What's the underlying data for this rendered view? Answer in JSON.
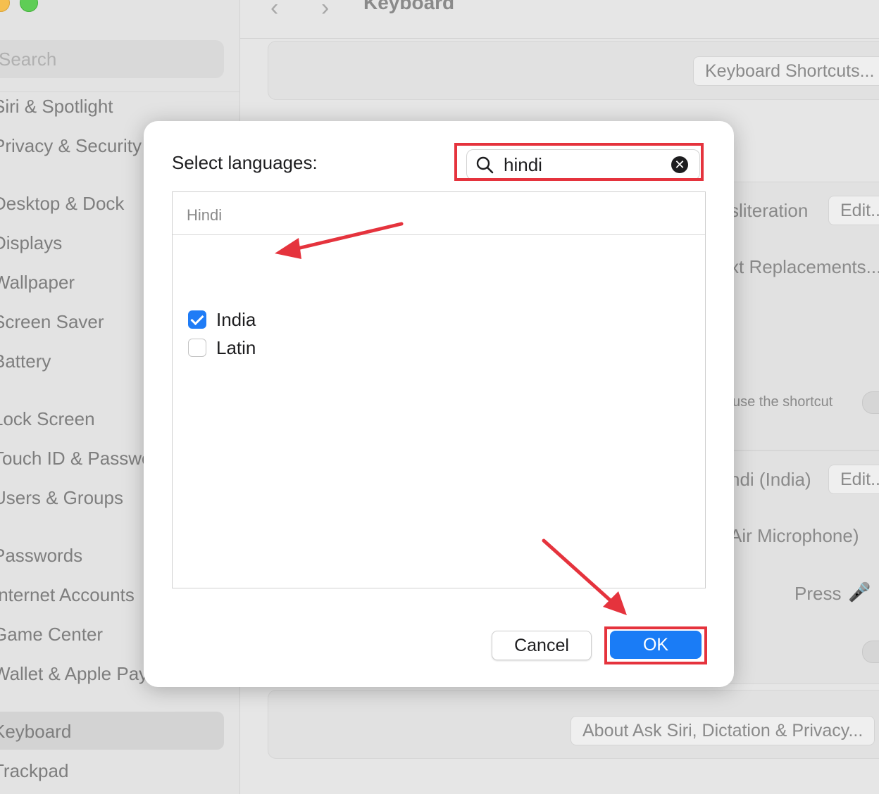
{
  "window": {
    "title": "Keyboard"
  },
  "sidebar": {
    "search_placeholder": "Search",
    "items": [
      "Siri & Spotlight",
      "Privacy & Security",
      "Desktop & Dock",
      "Displays",
      "Wallpaper",
      "Screen Saver",
      "Battery",
      "Lock Screen",
      "Touch ID & Password",
      "Users & Groups",
      "Passwords",
      "Internet Accounts",
      "Game Center",
      "Wallet & Apple Pay",
      "Keyboard",
      "Trackpad"
    ],
    "selected": "Keyboard"
  },
  "background": {
    "keyboard_shortcuts_btn": "Keyboard Shortcuts...",
    "transliteration_label": "Transliteration",
    "edit_btn": "Edit...",
    "text_replacements_btn": "Text Replacements...",
    "shortcut_text": "use the shortcut",
    "input_source_label": "Hindi (India)",
    "microphone_label": "AirPods Air Microphone)",
    "press_label": "Press",
    "about_btn": "About Ask Siri, Dictation & Privacy..."
  },
  "dialog": {
    "label": "Select languages:",
    "search_value": "hindi",
    "list_header": "Hindi",
    "options": [
      {
        "label": "India",
        "checked": true
      },
      {
        "label": "Latin",
        "checked": false
      }
    ],
    "cancel_label": "Cancel",
    "ok_label": "OK"
  },
  "colors": {
    "accent": "#1a7cf6",
    "highlight": "#e5333d"
  }
}
